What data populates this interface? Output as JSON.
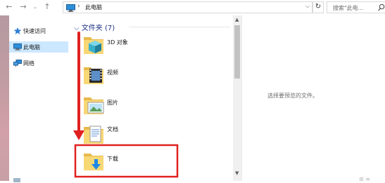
{
  "toolbar": {
    "back_icon": "back-arrow-icon",
    "forward_icon": "forward-arrow-icon",
    "recent_icon": "chevron-down-icon",
    "up_icon": "up-arrow-icon"
  },
  "address": {
    "path": "此电脑",
    "separator": "›",
    "dropdown": "⌵",
    "refresh": "↻"
  },
  "search": {
    "placeholder": "搜索\"此电..."
  },
  "sidebar": {
    "items": [
      {
        "label": "快速访问",
        "icon": "star-icon"
      },
      {
        "label": "此电脑",
        "icon": "computer-icon",
        "selected": true
      },
      {
        "label": "网络",
        "icon": "network-icon"
      }
    ]
  },
  "main": {
    "group_title": "文件夹 (7)",
    "folders": [
      {
        "label": "3D 对象",
        "icon": "3d-objects-folder-icon"
      },
      {
        "label": "视频",
        "icon": "videos-folder-icon"
      },
      {
        "label": "图片",
        "icon": "pictures-folder-icon"
      },
      {
        "label": "文档",
        "icon": "documents-folder-icon"
      },
      {
        "label": "下载",
        "icon": "downloads-folder-icon"
      }
    ]
  },
  "preview": {
    "empty_text": "选择要预览的文件。"
  },
  "colors": {
    "selection": "#cce8ff",
    "group_title": "#1e3287",
    "annotation_red": "#e02020",
    "folder_yellow": "#f8d775"
  }
}
